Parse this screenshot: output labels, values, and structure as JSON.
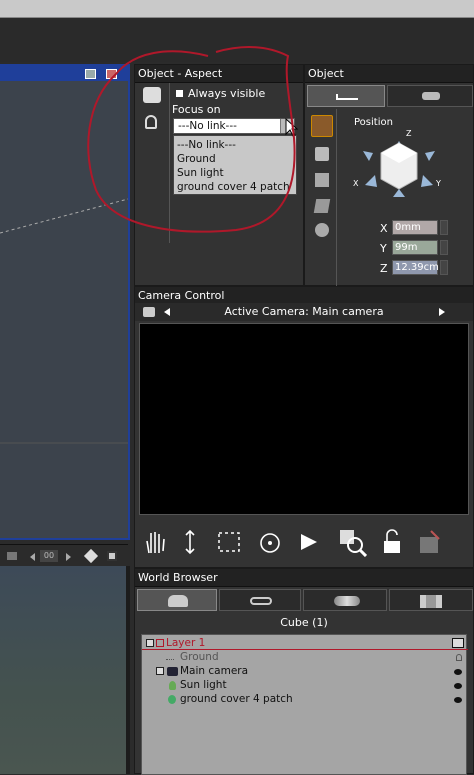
{
  "object_aspect": {
    "title": "Object - Aspect",
    "always_visible_label": "Always visible",
    "focus_on_label": "Focus on",
    "dropdown_value": "---No link---",
    "dropdown_options": [
      "---No link---",
      "Ground",
      "Sun light",
      "ground cover 4 patch"
    ]
  },
  "object_panel": {
    "title": "Object",
    "position_label": "Position",
    "axis_labels": {
      "z": "Z",
      "x": "X",
      "y": "Y"
    },
    "fields": [
      {
        "label": "X",
        "value": "0mm"
      },
      {
        "label": "Y",
        "value": "99m"
      },
      {
        "label": "Z",
        "value": "12.39cm"
      }
    ]
  },
  "camera_control": {
    "title": "Camera Control",
    "active_camera": "Active Camera: Main camera"
  },
  "viewport_toolbar": {
    "frame_value": "00"
  },
  "world_browser": {
    "title": "World Browser",
    "selection": "Cube (1)",
    "tree": [
      {
        "label": "Layer 1",
        "color": "#b0182a"
      },
      {
        "label": "Ground",
        "color": "#555555"
      },
      {
        "label": "Main camera",
        "color": "#111111"
      },
      {
        "label": "Sun light",
        "color": "#111111"
      },
      {
        "label": "ground cover 4 patch",
        "color": "#111111"
      }
    ]
  },
  "colors": {
    "viewport_border": "#1f3f9a",
    "annotation": "#b0182a",
    "panel": "#333333"
  }
}
